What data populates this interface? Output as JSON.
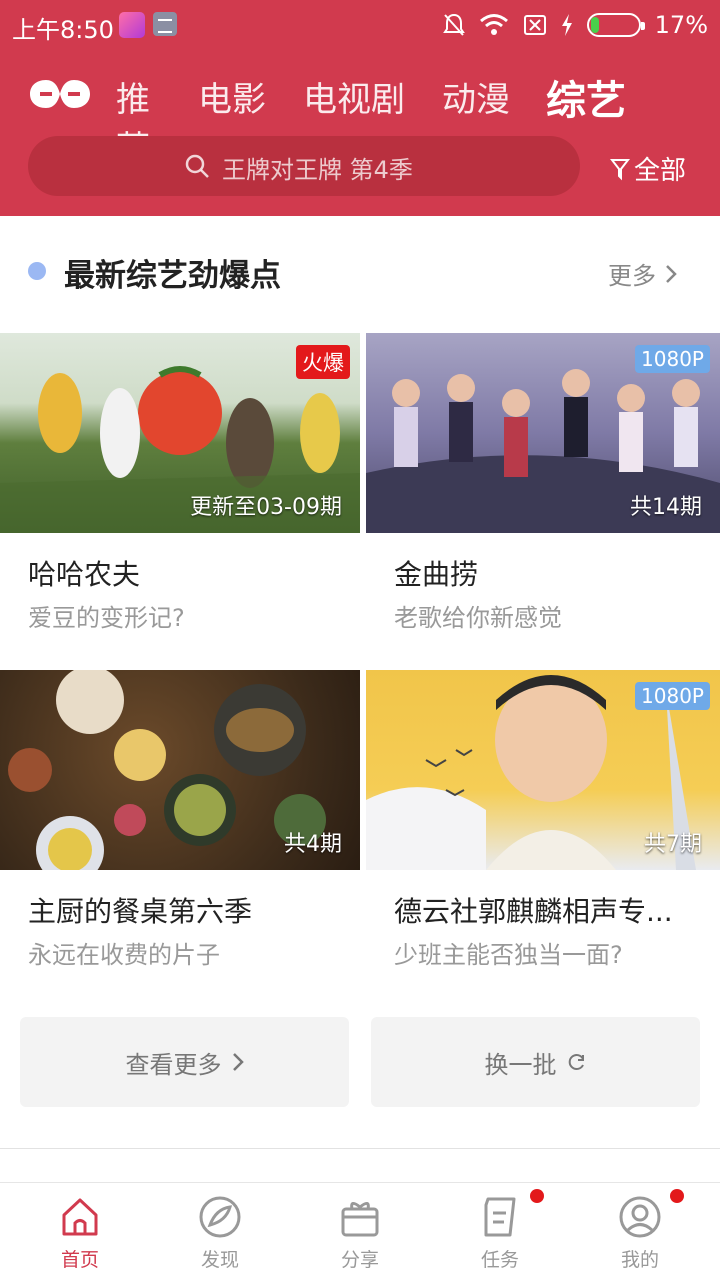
{
  "status_bar": {
    "time": "上午8:50",
    "battery": "17%",
    "battery_level": 0.17
  },
  "top_nav": {
    "tabs": [
      {
        "label": "推荐"
      },
      {
        "label": "电影"
      },
      {
        "label": "电视剧"
      },
      {
        "label": "动漫"
      },
      {
        "label": "综艺",
        "active": true
      }
    ],
    "search_placeholder": "王牌对王牌 第4季",
    "filter_label": "全部"
  },
  "section": {
    "title": "最新综艺劲爆点",
    "more_label": "更多"
  },
  "cards": [
    {
      "title": "哈哈农夫",
      "subtitle": "爱豆的变形记?",
      "badge": "火爆",
      "episode": "更新至03-09期"
    },
    {
      "title": "金曲捞",
      "subtitle": "老歌给你新感觉",
      "badge": "1080P",
      "episode": "共14期"
    },
    {
      "title": "主厨的餐桌第六季",
      "subtitle": "永远在收费的片子",
      "badge": "",
      "episode": "共4期"
    },
    {
      "title": "德云社郭麒麟相声专...",
      "subtitle": "少班主能否独当一面?",
      "badge": "1080P",
      "episode": "共7期"
    }
  ],
  "actions": {
    "see_more": "查看更多",
    "refresh": "换一批"
  },
  "bottom_nav": [
    {
      "label": "首页",
      "active": true
    },
    {
      "label": "发现"
    },
    {
      "label": "分享"
    },
    {
      "label": "任务",
      "dot": true
    },
    {
      "label": "我的",
      "dot": true
    }
  ],
  "colors": {
    "brand_red": "#d13a4e",
    "hot_badge": "#e3191b",
    "hd_badge": "#6fa9e8"
  }
}
